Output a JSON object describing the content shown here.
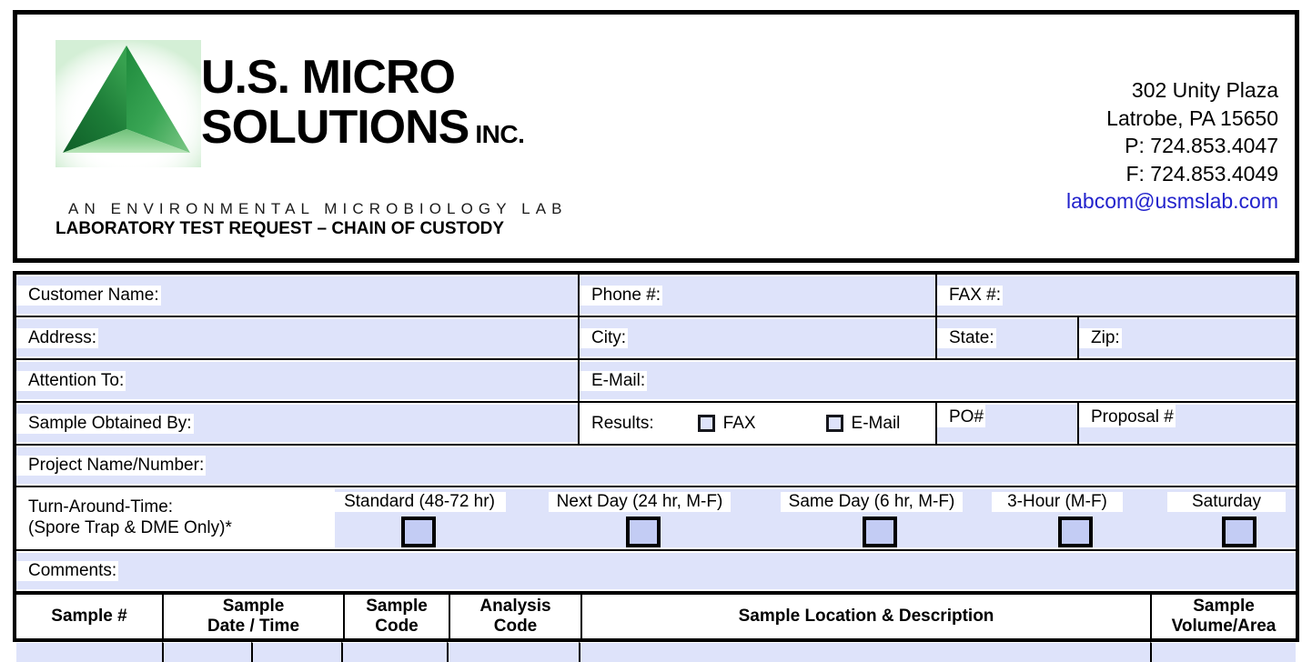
{
  "header": {
    "brand_line1": "U.S. MICRO",
    "brand_line2": "SOLUTIONS",
    "brand_suffix": "INC.",
    "tagline": "AN ENVIRONMENTAL MICROBIOLOGY LAB",
    "form_title": "LABORATORY TEST REQUEST – CHAIN OF CUSTODY",
    "address": {
      "street": "302 Unity Plaza",
      "city_state_zip": "Latrobe, PA 15650",
      "phone": "P: 724.853.4047",
      "fax": "F: 724.853.4049",
      "email": "labcom@usmslab.com"
    },
    "logo_colors": {
      "face_left": "#1b7a36",
      "face_right": "#3faa56",
      "face_bottom": "#97d69b",
      "glow": "#d6f0d8"
    },
    "email_color": "#2222cc"
  },
  "form": {
    "fill_color": "#dee3fa",
    "row1": {
      "customer_name_label": "Customer Name:",
      "customer_name_value": "",
      "phone_label": "Phone #:",
      "phone_value": "",
      "fax_label": "FAX #:",
      "fax_value": ""
    },
    "row2": {
      "address_label": "Address:",
      "address_value": "",
      "city_label": "City:",
      "city_value": "",
      "state_label": "State:",
      "state_value": "",
      "zip_label": "Zip:",
      "zip_value": ""
    },
    "row3": {
      "attention_label": "Attention To:",
      "attention_value": "",
      "email_label": "E-Mail:",
      "email_value": ""
    },
    "row4": {
      "obtained_by_label": "Sample Obtained By:",
      "obtained_by_value": "",
      "results_label": "Results:",
      "results_options": [
        {
          "label": "FAX",
          "checked": false
        },
        {
          "label": "E-Mail",
          "checked": false
        }
      ],
      "po_label": "PO#",
      "po_value": "",
      "proposal_label": "Proposal #",
      "proposal_value": ""
    },
    "row5": {
      "project_label": "Project Name/Number:",
      "project_value": ""
    },
    "turn_around": {
      "label_line1": "Turn-Around-Time:",
      "label_line2": "(Spore Trap & DME Only)*",
      "options": [
        {
          "label": "Standard (48-72 hr)",
          "checked": false
        },
        {
          "label": "Next Day (24 hr, M-F)",
          "checked": false
        },
        {
          "label": "Same Day (6 hr, M-F)",
          "checked": false
        },
        {
          "label": "3-Hour (M-F)",
          "checked": false
        },
        {
          "label": "Saturday",
          "checked": false
        }
      ]
    },
    "comments": {
      "label": "Comments:",
      "value": ""
    }
  },
  "sample_table": {
    "columns": [
      {
        "line1": "Sample #",
        "line2": ""
      },
      {
        "line1": "Sample",
        "line2": "Date  /  Time"
      },
      {
        "line1": "Sample",
        "line2": "Code"
      },
      {
        "line1": "Analysis",
        "line2": "Code"
      },
      {
        "line1": "Sample Location & Description",
        "line2": ""
      },
      {
        "line1": "Sample",
        "line2": "Volume/Area"
      }
    ],
    "rows": [
      {
        "sample_no": "",
        "date": "",
        "time": "",
        "sample_code": "",
        "analysis_code": "",
        "location": "",
        "volume_area": ""
      }
    ]
  }
}
